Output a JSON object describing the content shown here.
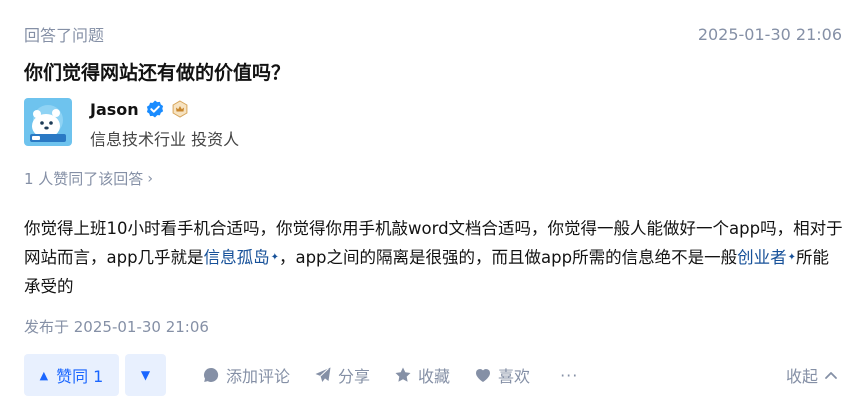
{
  "header": {
    "activity": "回答了问题",
    "timestamp": "2025-01-30 21:06"
  },
  "question": {
    "title": "你们觉得网站还有做的价值吗？"
  },
  "author": {
    "name": "Jason",
    "headline": "信息技术行业 投资人",
    "avatar_icon": "polar-bear-avatar",
    "verified_icon": "verified-check-icon",
    "level_icon": "crown-badge-icon"
  },
  "votes": {
    "text": "1 人赞同了该回答",
    "chevron": "›"
  },
  "content": {
    "part1": "你觉得上班10小时看手机合适吗，你觉得你用手机敲word文档合适吗，你觉得一般人能做好一个app吗，相对于网站而言，app几乎就是",
    "link1": "信息孤岛",
    "part2": "，app之间的隔离是很强的，而且做app所需的信息绝不是一般",
    "link2": "创业者",
    "part3": "所能承受的",
    "spark": "✦"
  },
  "published": "发布于 2025-01-30 21:06",
  "actions": {
    "upvote_label": "赞同 1",
    "upvote_arrow": "▲",
    "downvote_arrow": "▼",
    "comment": "添加评论",
    "share": "分享",
    "favorite": "收藏",
    "like": "喜欢",
    "more": "···",
    "collapse": "收起"
  },
  "colors": {
    "accent": "#1a66ff",
    "link": "#175199",
    "meta": "#8590a6"
  }
}
